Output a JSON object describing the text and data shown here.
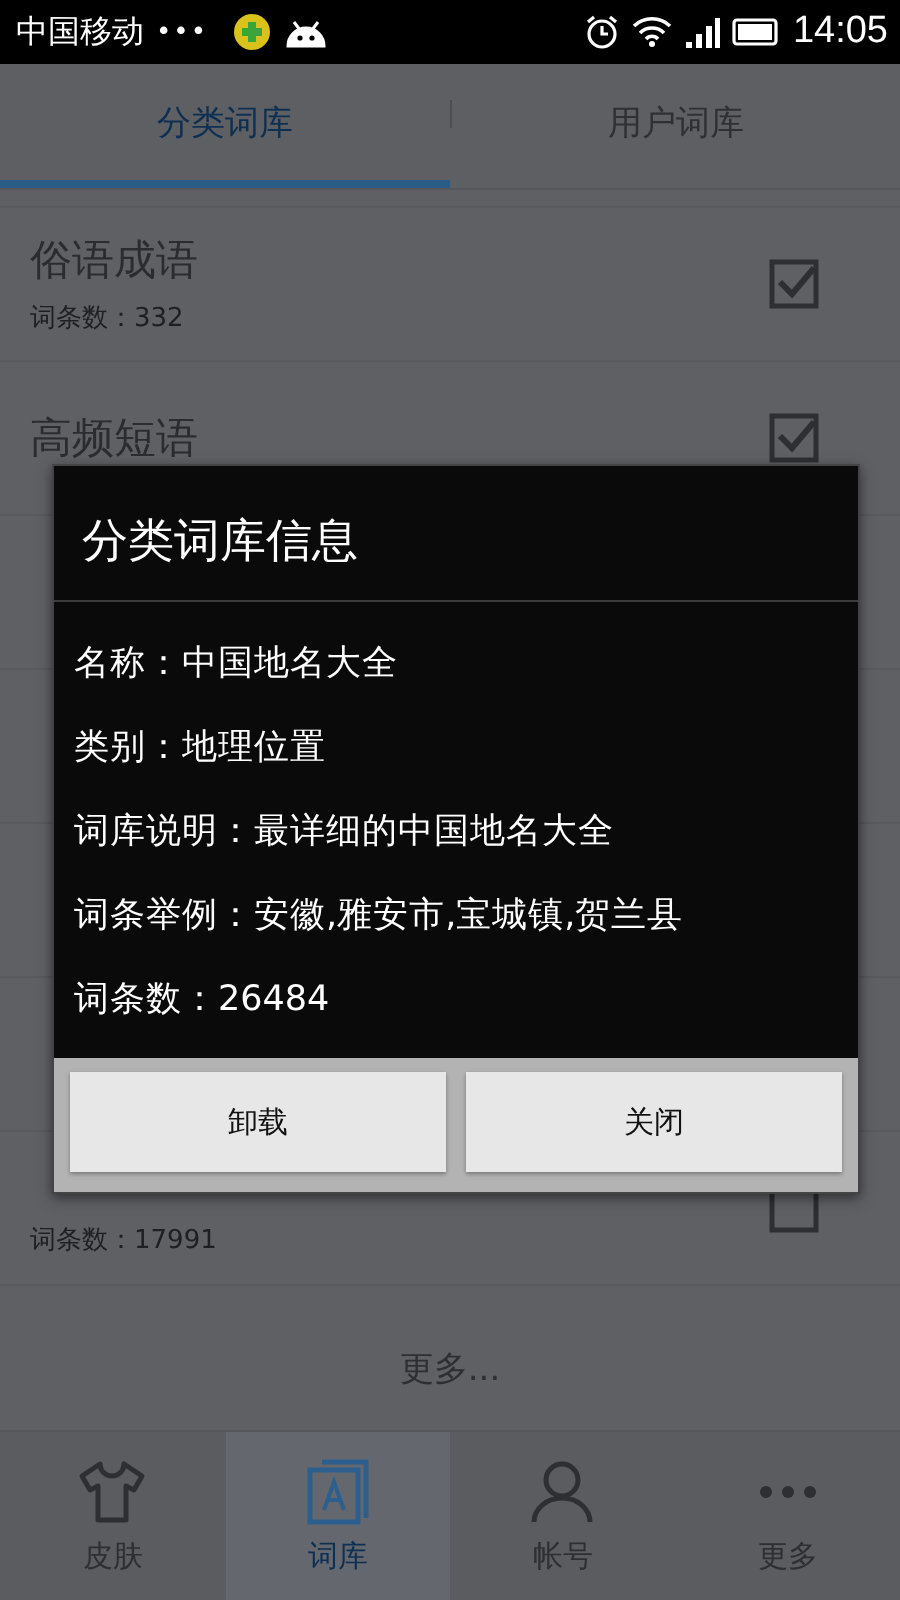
{
  "status_bar": {
    "carrier": "中国移动",
    "dots": "•••",
    "time": "14:05"
  },
  "tabs": [
    {
      "label": "分类词库",
      "selected": true
    },
    {
      "label": "用户词库",
      "selected": false
    }
  ],
  "list": {
    "items": [
      {
        "name": "俗语成语",
        "count": "词条数：332",
        "checked": true
      },
      {
        "name": "高频短语",
        "checked": true
      },
      {
        "count": "词条数：17991",
        "checked": false
      }
    ],
    "more": "更多..."
  },
  "dialog": {
    "title": "分类词库信息",
    "lines": [
      "名称：中国地名大全",
      "类别：地理位置",
      "词库说明：最详细的中国地名大全",
      "词条举例：安徽,雅安市,宝城镇,贺兰县",
      "词条数：26484"
    ],
    "buttons": [
      "卸载",
      "关闭"
    ]
  },
  "bottom_nav": [
    {
      "kind": "shirt",
      "label": "皮肤",
      "selected": false
    },
    {
      "kind": "dict",
      "label": "词库",
      "selected": true
    },
    {
      "kind": "person",
      "label": "帐号",
      "selected": false
    },
    {
      "kind": "more",
      "label": "更多",
      "selected": false
    }
  ]
}
